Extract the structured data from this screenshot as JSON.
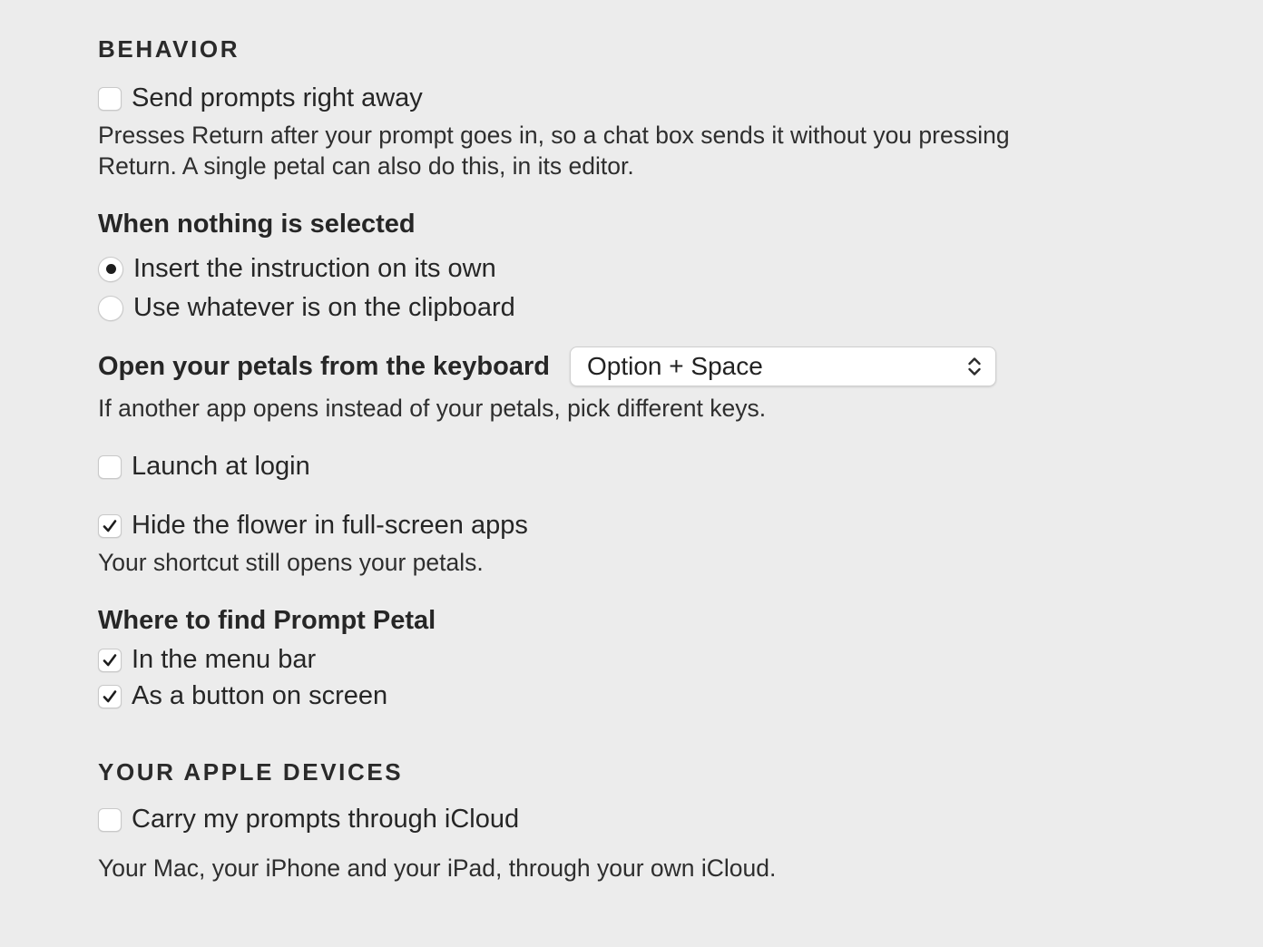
{
  "behavior": {
    "section_title": "BEHAVIOR",
    "send_prompts": {
      "label": "Send prompts right away",
      "checked": false,
      "description_line1": "Presses Return after your prompt goes in, so a chat box sends it without you pressing",
      "description_line2": "Return. A single petal can also do this, in its editor."
    },
    "nothing_selected": {
      "title": "When nothing is selected",
      "options": [
        {
          "label": "Insert the instruction on its own",
          "selected": true
        },
        {
          "label": "Use whatever is on the clipboard",
          "selected": false
        }
      ]
    },
    "keyboard": {
      "label": "Open your petals from the keyboard",
      "shortcut_value": "Option + Space",
      "description": "If another app opens instead of your petals, pick different keys."
    },
    "launch_at_login": {
      "label": "Launch at login",
      "checked": false
    },
    "hide_flower": {
      "label": "Hide the flower in full-screen apps",
      "checked": true,
      "description": "Your shortcut still opens your petals."
    },
    "where_to_find": {
      "title": "Where to find Prompt Petal",
      "options": [
        {
          "label": "In the menu bar",
          "checked": true
        },
        {
          "label": "As a button on screen",
          "checked": true
        }
      ]
    }
  },
  "devices": {
    "section_title": "YOUR APPLE DEVICES",
    "icloud": {
      "label": "Carry my prompts through iCloud",
      "checked": false,
      "description": "Your Mac, your iPhone and your iPad, through your own iCloud."
    }
  },
  "icons": {
    "checkmark": "checkmark-icon",
    "radio_dot": "radio-dot-icon",
    "popup_arrows": "chevron-up-down-icon"
  },
  "colors": {
    "background": "#ececec",
    "control_fill": "#ffffff",
    "control_border": "#c9c9c9",
    "text": "#262626"
  }
}
